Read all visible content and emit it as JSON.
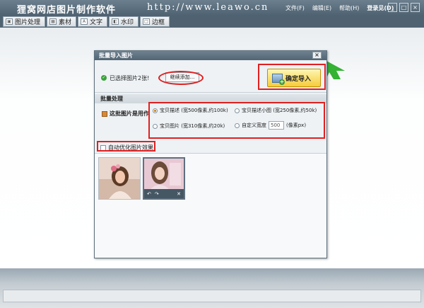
{
  "app": {
    "title": "狸窝网店图片制作软件",
    "url": "http://www.leawo.cn"
  },
  "menu": {
    "file": "文件(F)",
    "edit": "编辑(E)",
    "help": "帮助(H)",
    "login": "登录见(D)"
  },
  "window_controls": {
    "minimize": "_",
    "maximize": "□",
    "close": "×"
  },
  "tabs": [
    {
      "label": "图片处理",
      "icon": "image-icon"
    },
    {
      "label": "素材",
      "icon": "material-icon"
    },
    {
      "label": "文字",
      "icon": "text-icon"
    },
    {
      "label": "水印",
      "icon": "watermark-icon"
    },
    {
      "label": "边框",
      "icon": "border-icon"
    }
  ],
  "dialog": {
    "title": "批量导入图片",
    "close": "×",
    "selected_text": "已选择图片2张!",
    "add_more": "继续添加...",
    "confirm": "确定导入",
    "section_title": "批量处理",
    "use_label": "这批图片是用作",
    "options": [
      {
        "label": "宝贝描述",
        "detail": "(宽500像素,约100k)",
        "selected": true
      },
      {
        "label": "宝贝描述小图",
        "detail": "(宽250像素,约50k)",
        "selected": false
      },
      {
        "label": "宝贝图片",
        "detail": "(宽310像素,约20k)",
        "selected": false
      },
      {
        "label": "自定义宽度",
        "detail": "(像素px)",
        "selected": false
      }
    ],
    "custom_width_value": "500",
    "optimize_label": "自动优化图片效果",
    "thumb_actions": {
      "rotate_left": "↶",
      "rotate_right": "↷",
      "delete": "✕"
    }
  },
  "colors": {
    "titlebar": "#56697a",
    "highlight": "#e02020",
    "confirm_button": "#f5cd3c",
    "arrow": "#33b233"
  }
}
